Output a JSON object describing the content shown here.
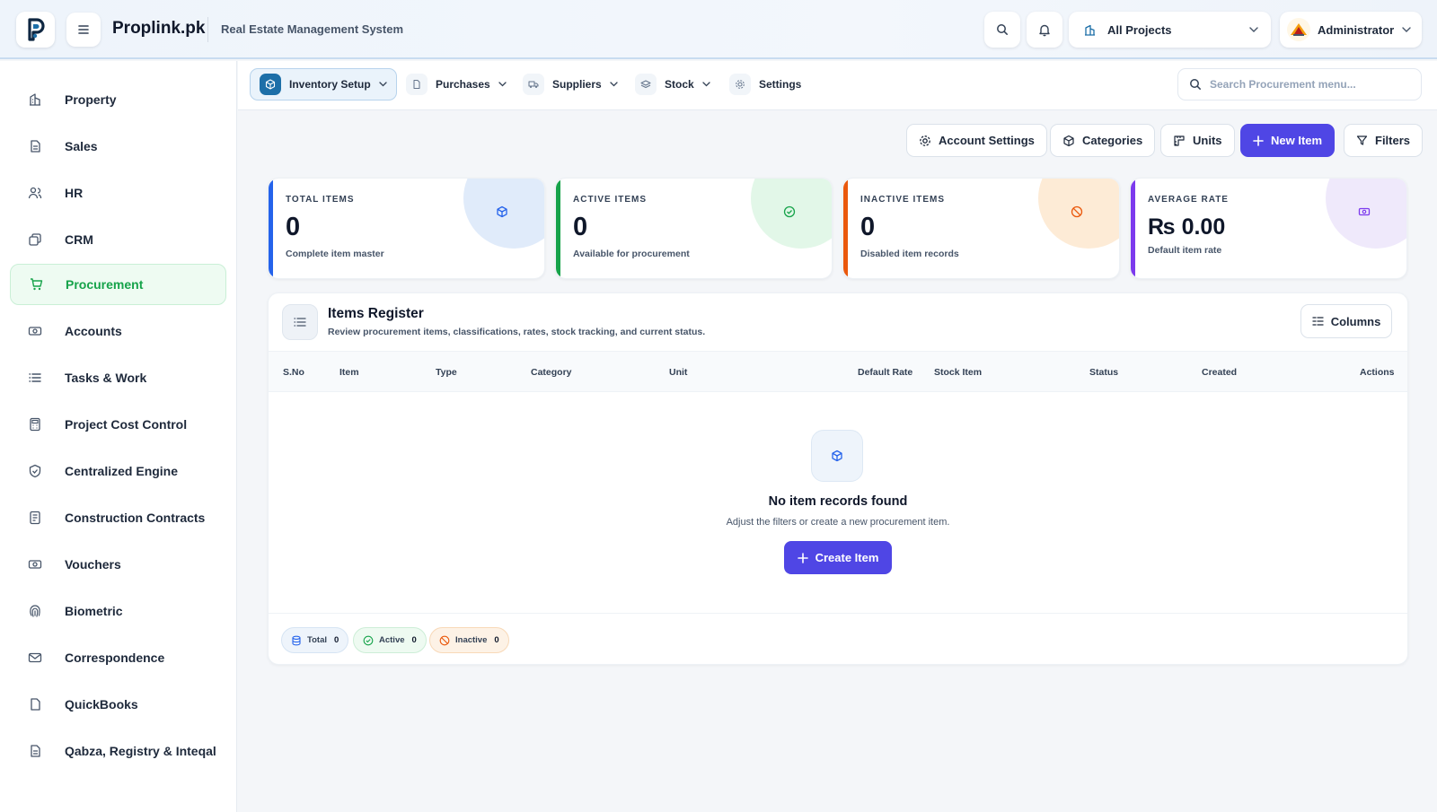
{
  "header": {
    "brand": "Proplink.pk",
    "subtitle": "Real Estate Management System",
    "project_label": "All Projects",
    "user_label": "Administrator"
  },
  "sidebar": {
    "items": [
      {
        "label": "Property",
        "icon": "building-icon"
      },
      {
        "label": "Sales",
        "icon": "document-icon"
      },
      {
        "label": "HR",
        "icon": "users-icon"
      },
      {
        "label": "CRM",
        "icon": "crm-icon"
      },
      {
        "label": "Procurement",
        "icon": "cart-icon",
        "active": true
      },
      {
        "label": "Accounts",
        "icon": "cash-icon"
      },
      {
        "label": "Tasks & Work",
        "icon": "list-icon"
      },
      {
        "label": "Project Cost Control",
        "icon": "calculator-icon"
      },
      {
        "label": "Centralized Engine",
        "icon": "shield-icon"
      },
      {
        "label": "Construction Contracts",
        "icon": "contract-icon"
      },
      {
        "label": "Vouchers",
        "icon": "voucher-icon"
      },
      {
        "label": "Biometric",
        "icon": "fingerprint-icon"
      },
      {
        "label": "Correspondence",
        "icon": "mail-icon"
      },
      {
        "label": "QuickBooks",
        "icon": "file-icon"
      },
      {
        "label": "Qabza, Registry & Inteqal",
        "icon": "registry-icon"
      }
    ]
  },
  "subnav": {
    "tabs": [
      {
        "label": "Inventory Setup",
        "active": true
      },
      {
        "label": "Purchases"
      },
      {
        "label": "Suppliers"
      },
      {
        "label": "Stock"
      },
      {
        "label": "Settings"
      }
    ],
    "search_placeholder": "Search Procurement menu..."
  },
  "actions": {
    "account_settings": "Account Settings",
    "categories": "Categories",
    "units": "Units",
    "new_item": "New Item",
    "filters": "Filters"
  },
  "stats": [
    {
      "title": "TOTAL ITEMS",
      "value": "0",
      "desc": "Complete item master",
      "color": "#2563eb"
    },
    {
      "title": "ACTIVE ITEMS",
      "value": "0",
      "desc": "Available for procurement",
      "color": "#16a34a"
    },
    {
      "title": "INACTIVE ITEMS",
      "value": "0",
      "desc": "Disabled item records",
      "color": "#ea580c"
    },
    {
      "title": "AVERAGE RATE",
      "value": "₨ 0.00",
      "desc": "Default item rate",
      "color": "#7c3aed"
    }
  ],
  "register": {
    "title": "Items Register",
    "subtitle": "Review procurement items, classifications, rates, stock tracking, and current status.",
    "columns_label": "Columns",
    "headers": [
      "S.No",
      "Item",
      "Type",
      "Category",
      "Unit",
      "Default Rate",
      "Stock Item",
      "Status",
      "Created",
      "Actions"
    ],
    "empty_title": "No item records found",
    "empty_sub": "Adjust the filters or create a new procurement item.",
    "create_label": "Create Item",
    "footer": {
      "total_label": "Total",
      "total_count": "0",
      "active_label": "Active",
      "active_count": "0",
      "inactive_label": "Inactive",
      "inactive_count": "0"
    }
  }
}
